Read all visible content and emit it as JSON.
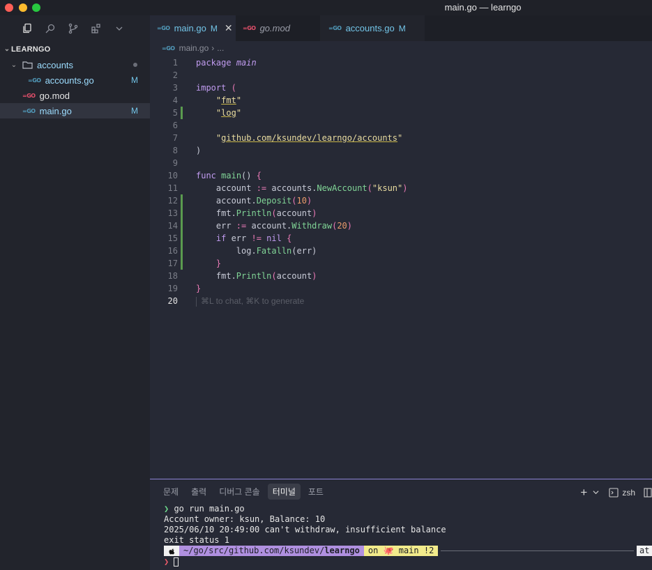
{
  "window": {
    "title": "main.go — learngo"
  },
  "sidebar": {
    "section_title": "LEARNGO",
    "activity_icons": [
      "files-icon",
      "search-icon",
      "source-control-icon",
      "extensions-icon",
      "chevron-down-icon"
    ],
    "tree": [
      {
        "label": "accounts",
        "type": "folder",
        "status": ""
      },
      {
        "label": "accounts.go",
        "type": "go",
        "status": "M"
      },
      {
        "label": "go.mod",
        "type": "mod",
        "status": ""
      },
      {
        "label": "main.go",
        "type": "go",
        "status": "M"
      }
    ]
  },
  "tabs": [
    {
      "label": "main.go",
      "status": "M",
      "close": "✕"
    },
    {
      "label": "go.mod",
      "status": ""
    },
    {
      "label": "accounts.go",
      "status": "M"
    }
  ],
  "breadcrumb": {
    "file": "main.go",
    "sep": "›",
    "more": "..."
  },
  "editor": {
    "line_numbers": [
      "1",
      "2",
      "3",
      "4",
      "5",
      "6",
      "7",
      "8",
      "9",
      "10",
      "11",
      "12",
      "13",
      "14",
      "15",
      "16",
      "17",
      "18",
      "19",
      "20"
    ],
    "current_line": "20",
    "hint": "⌘L to chat, ⌘K to generate"
  },
  "panel": {
    "tabs": [
      "문제",
      "출력",
      "디버그 콘솔",
      "터미널",
      "포트"
    ],
    "active_tab": "터미널",
    "shell": "zsh",
    "plus": "+",
    "terminal_lines": [
      "go run main.go",
      "Account owner: ksun, Balance: 10",
      "2025/06/10 20:49:00 can't withdraw, insufficient balance",
      "exit status 1"
    ],
    "prompt_path": "~/go/src/github.com/ksundev/",
    "prompt_dir": "learngo",
    "prompt_git": "on 🐙 main !2",
    "prompt_right": "at"
  },
  "colors": {
    "accent": "#73c5e8",
    "panel_border": "#8e84d6",
    "git_added": "#5a9b4f"
  }
}
